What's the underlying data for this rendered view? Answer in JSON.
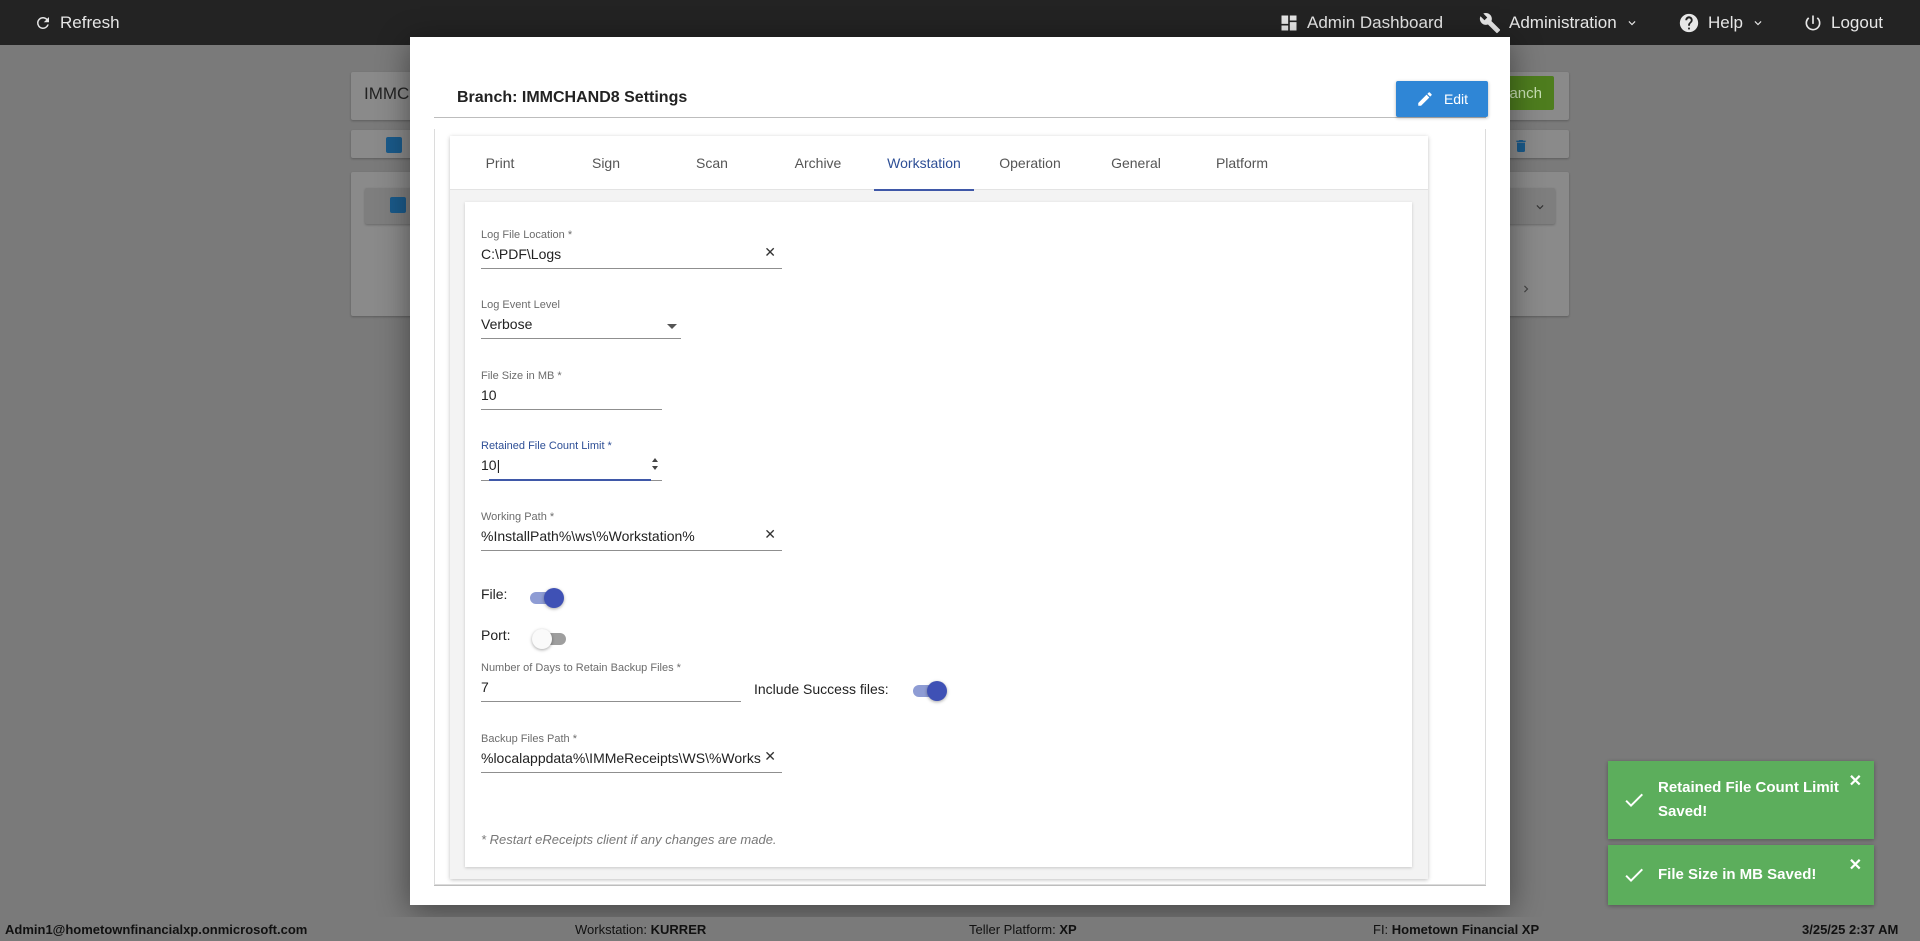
{
  "topbar": {
    "refresh": "Refresh",
    "admin_dashboard": "Admin Dashboard",
    "administration": "Administration",
    "help": "Help",
    "logout": "Logout"
  },
  "background": {
    "search_value": "IMMC",
    "add_branch_label": "anch"
  },
  "modal": {
    "title": "Branch: IMMCHAND8 Settings",
    "edit_label": "Edit",
    "tabs": [
      {
        "label": "Print"
      },
      {
        "label": "Sign"
      },
      {
        "label": "Scan"
      },
      {
        "label": "Archive"
      },
      {
        "label": "Workstation",
        "active": true
      },
      {
        "label": "Operation"
      },
      {
        "label": "General"
      },
      {
        "label": "Platform"
      }
    ],
    "fields": {
      "log_file_location": {
        "label": "Log File Location *",
        "value": "C:\\PDF\\Logs"
      },
      "log_event_level": {
        "label": "Log Event Level",
        "value": "Verbose"
      },
      "file_size": {
        "label": "File Size in MB *",
        "value": "10"
      },
      "retained_count": {
        "label": "Retained File Count Limit *",
        "value": "10|"
      },
      "working_path": {
        "label": "Working Path *",
        "value": "%InstallPath%\\ws\\%Workstation%"
      },
      "backup_days": {
        "label": "Number of Days to Retain Backup Files *",
        "value": "7"
      },
      "backup_path": {
        "label": "Backup Files Path *",
        "value": "%localappdata%\\IMMeReceipts\\WS\\%Works"
      }
    },
    "toggles": {
      "file": {
        "label": "File:",
        "on": true
      },
      "port": {
        "label": "Port:",
        "on": false
      },
      "include_success": {
        "label": "Include Success files:",
        "on": true
      }
    },
    "note": "* Restart eReceipts client if any changes are made."
  },
  "toasts": [
    {
      "line1": "Retained File Count Limit",
      "line2": "Saved!"
    },
    {
      "line1": "File Size in MB Saved!"
    }
  ],
  "status": {
    "user": "Admin1@hometownfinancialxp.onmicrosoft.com",
    "workstation_label": "Workstation:",
    "workstation_value": "KURRER",
    "platform_label": "Teller Platform:",
    "platform_value": "XP",
    "fi_label": "FI:",
    "fi_value": "Hometown Financial XP",
    "datetime": "3/25/25 2:37 AM"
  },
  "colors": {
    "accent": "#3f51b5",
    "edit_button": "#2f86d6",
    "toast_success": "#5cae5c",
    "topbar": "#232323"
  }
}
